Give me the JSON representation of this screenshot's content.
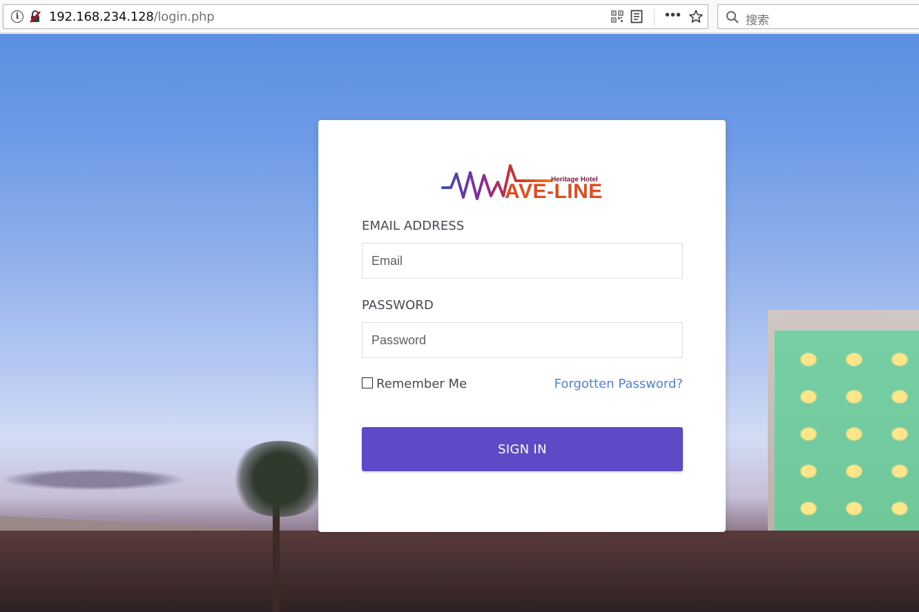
{
  "browser": {
    "url_host": "192.168.234.128",
    "url_path": "/login.php",
    "search_placeholder": "搜索",
    "icons": [
      "info-icon",
      "insecure-lock-icon",
      "qr-code-icon",
      "reader-view-icon",
      "more-icon",
      "bookmark-star-icon",
      "search-icon"
    ]
  },
  "login": {
    "logo_tagline": "Heritage Hotel",
    "logo_brand": "AVE-LINE",
    "email_label": "EMAIL ADDRESS",
    "email_placeholder": "Email",
    "password_label": "PASSWORD",
    "password_placeholder": "Password",
    "remember_label": "Remember Me",
    "remember_checked": false,
    "forgot_label": "Forgotten Password?",
    "signin_label": "SIGN IN"
  },
  "colors": {
    "accent": "#5c4ac6",
    "link": "#4c7fe0",
    "logo_orange": "#e24a1f",
    "logo_purple": "#8b2a9a"
  }
}
